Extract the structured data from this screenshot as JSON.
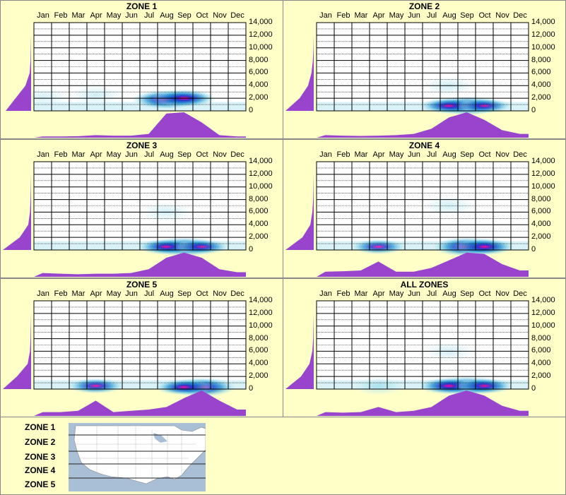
{
  "months": [
    "Jan",
    "Feb",
    "Mar",
    "Apr",
    "May",
    "Jun",
    "Jul",
    "Aug",
    "Sep",
    "Oct",
    "Nov",
    "Dec"
  ],
  "y_ticks": [
    "14,000",
    "12,000",
    "10,000",
    "8,000",
    "6,000",
    "4,000",
    "2,000",
    "0"
  ],
  "chart_data": [
    {
      "type": "heatmap",
      "title": "ZONE 1",
      "x": [
        "Jan",
        "Feb",
        "Mar",
        "Apr",
        "May",
        "Jun",
        "Jul",
        "Aug",
        "Sep",
        "Oct",
        "Nov",
        "Dec"
      ],
      "ylim": [
        0,
        14000
      ],
      "hotspots": [
        {
          "month": "Aug",
          "elevation": 1800,
          "intensity": 1.0
        },
        {
          "month": "Sep",
          "elevation": 2000,
          "intensity": 0.8
        },
        {
          "month": "Apr",
          "elevation": 2500,
          "intensity": 0.15
        },
        {
          "month": "Jan",
          "elevation": 2200,
          "intensity": 0.1
        }
      ],
      "monthly_profile": [
        0.05,
        0.05,
        0.06,
        0.1,
        0.08,
        0.08,
        0.15,
        0.95,
        1.0,
        0.6,
        0.1,
        0.05
      ],
      "elevation_profile": [
        0.9,
        0.55,
        0.2,
        0.05,
        0.02,
        0.01,
        0.0,
        0.0
      ]
    },
    {
      "type": "heatmap",
      "title": "ZONE 2",
      "x": [
        "Jan",
        "Feb",
        "Mar",
        "Apr",
        "May",
        "Jun",
        "Jul",
        "Aug",
        "Sep",
        "Oct",
        "Nov",
        "Dec"
      ],
      "ylim": [
        0,
        14000
      ],
      "hotspots": [
        {
          "month": "Sep",
          "elevation": 800,
          "intensity": 1.0
        },
        {
          "month": "Aug",
          "elevation": 800,
          "intensity": 0.6
        },
        {
          "month": "Oct",
          "elevation": 800,
          "intensity": 0.5
        },
        {
          "month": "Aug",
          "elevation": 4000,
          "intensity": 0.15
        }
      ],
      "monthly_profile": [
        0.1,
        0.08,
        0.07,
        0.08,
        0.1,
        0.15,
        0.35,
        0.8,
        1.0,
        0.7,
        0.3,
        0.15
      ],
      "elevation_profile": [
        1.0,
        0.5,
        0.2,
        0.08,
        0.03,
        0.01,
        0.0,
        0.0
      ]
    },
    {
      "type": "heatmap",
      "title": "ZONE 3",
      "x": [
        "Jan",
        "Feb",
        "Mar",
        "Apr",
        "May",
        "Jun",
        "Jul",
        "Aug",
        "Sep",
        "Oct",
        "Nov",
        "Dec"
      ],
      "ylim": [
        0,
        14000
      ],
      "hotspots": [
        {
          "month": "Sep",
          "elevation": 500,
          "intensity": 1.0
        },
        {
          "month": "Aug",
          "elevation": 500,
          "intensity": 0.6
        },
        {
          "month": "Oct",
          "elevation": 500,
          "intensity": 0.5
        },
        {
          "month": "Aug",
          "elevation": 6000,
          "intensity": 0.15
        }
      ],
      "monthly_profile": [
        0.15,
        0.12,
        0.1,
        0.12,
        0.12,
        0.15,
        0.3,
        0.75,
        0.95,
        0.75,
        0.3,
        0.18
      ],
      "elevation_profile": [
        1.0,
        0.4,
        0.1,
        0.04,
        0.02,
        0.01,
        0.0,
        0.0
      ]
    },
    {
      "type": "heatmap",
      "title": "ZONE 4",
      "x": [
        "Jan",
        "Feb",
        "Mar",
        "Apr",
        "May",
        "Jun",
        "Jul",
        "Aug",
        "Sep",
        "Oct",
        "Nov",
        "Dec"
      ],
      "ylim": [
        0,
        14000
      ],
      "hotspots": [
        {
          "month": "Sep",
          "elevation": 500,
          "intensity": 1.0
        },
        {
          "month": "Oct",
          "elevation": 500,
          "intensity": 0.7
        },
        {
          "month": "Apr",
          "elevation": 500,
          "intensity": 0.5
        },
        {
          "month": "Aug",
          "elevation": 7000,
          "intensity": 0.15
        }
      ],
      "monthly_profile": [
        0.2,
        0.22,
        0.25,
        0.6,
        0.2,
        0.2,
        0.35,
        0.65,
        0.95,
        0.9,
        0.5,
        0.25
      ],
      "elevation_profile": [
        1.0,
        0.4,
        0.12,
        0.05,
        0.02,
        0.01,
        0.0,
        0.0
      ]
    },
    {
      "type": "heatmap",
      "title": "ZONE 5",
      "x": [
        "Jan",
        "Feb",
        "Mar",
        "Apr",
        "May",
        "Jun",
        "Jul",
        "Aug",
        "Sep",
        "Oct",
        "Nov",
        "Dec"
      ],
      "ylim": [
        0,
        14000
      ],
      "hotspots": [
        {
          "month": "Oct",
          "elevation": 300,
          "intensity": 1.0
        },
        {
          "month": "Sep",
          "elevation": 300,
          "intensity": 0.6
        },
        {
          "month": "Apr",
          "elevation": 500,
          "intensity": 0.55
        }
      ],
      "monthly_profile": [
        0.15,
        0.15,
        0.2,
        0.6,
        0.15,
        0.2,
        0.25,
        0.35,
        0.7,
        1.0,
        0.6,
        0.25
      ],
      "elevation_profile": [
        1.0,
        0.5,
        0.12,
        0.04,
        0.02,
        0.01,
        0.0,
        0.0
      ]
    },
    {
      "type": "heatmap",
      "title": "ALL ZONES",
      "x": [
        "Jan",
        "Feb",
        "Mar",
        "Apr",
        "May",
        "Jun",
        "Jul",
        "Aug",
        "Sep",
        "Oct",
        "Nov",
        "Dec"
      ],
      "ylim": [
        0,
        14000
      ],
      "hotspots": [
        {
          "month": "Sep",
          "elevation": 500,
          "intensity": 1.0
        },
        {
          "month": "Aug",
          "elevation": 500,
          "intensity": 0.7
        },
        {
          "month": "Oct",
          "elevation": 500,
          "intensity": 0.6
        },
        {
          "month": "Apr",
          "elevation": 500,
          "intensity": 0.35
        },
        {
          "month": "Aug",
          "elevation": 6000,
          "intensity": 0.12
        }
      ],
      "monthly_profile": [
        0.15,
        0.13,
        0.15,
        0.35,
        0.15,
        0.2,
        0.35,
        0.8,
        1.0,
        0.8,
        0.4,
        0.2
      ],
      "elevation_profile": [
        1.0,
        0.45,
        0.15,
        0.05,
        0.02,
        0.01,
        0.0,
        0.0
      ]
    }
  ],
  "legend": {
    "zones": [
      "ZONE 1",
      "ZONE 2",
      "ZONE 3",
      "ZONE 4",
      "ZONE 5"
    ]
  },
  "colors": {
    "background": "#ffffc8",
    "profile": "#9944cc",
    "cold": "#bfeaf2",
    "warm": "#1e66c8",
    "hot": "#ff0099"
  }
}
